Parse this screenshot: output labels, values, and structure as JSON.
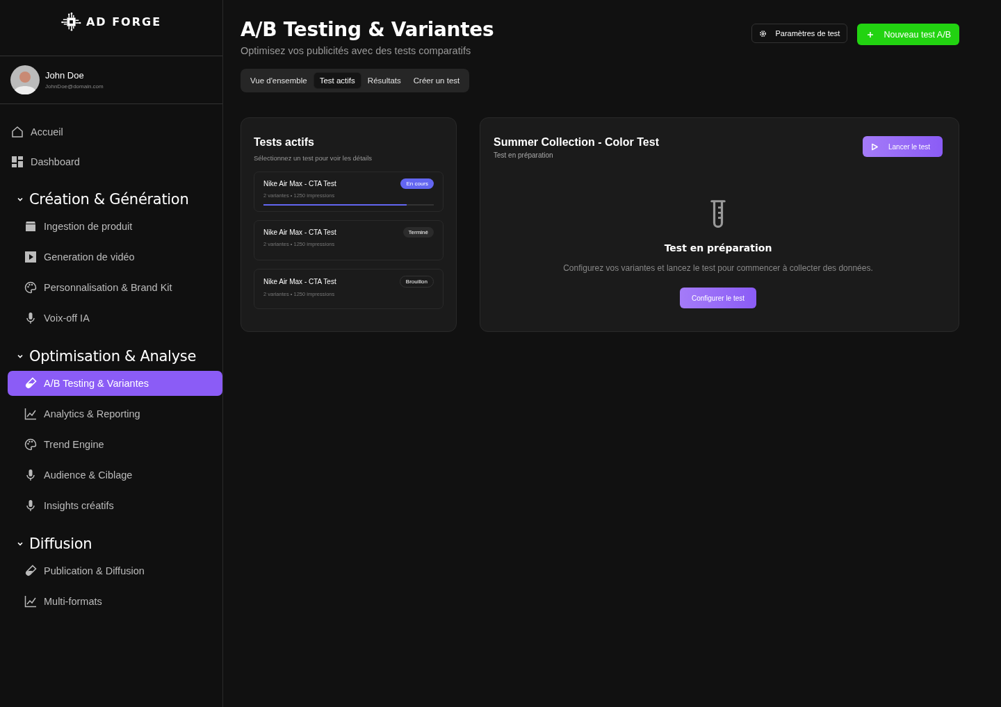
{
  "brand": {
    "name": "AD FORGE"
  },
  "user": {
    "name": "John Doe",
    "email": "JohnDoe@domain.com"
  },
  "nav": [
    {
      "label": "Accueil",
      "kind": "home",
      "selected": false
    },
    {
      "label": "Dashboard",
      "kind": "dashboard",
      "selected": false
    }
  ],
  "sections": [
    {
      "title": "Création & Génération",
      "expanded": true,
      "items": [
        {
          "label": "Ingestion de produit",
          "kind": "box",
          "selected": false
        },
        {
          "label": "Generation de vidéo",
          "kind": "video",
          "selected": false
        },
        {
          "label": "Personnalisation & Brand Kit",
          "kind": "palette",
          "selected": false
        },
        {
          "label": "Voix-off IA",
          "kind": "mic",
          "selected": false
        }
      ]
    },
    {
      "title": "Optimisation & Analyse",
      "expanded": true,
      "items": [
        {
          "label": "A/B Testing & Variantes",
          "kind": "tube",
          "selected": true
        },
        {
          "label": "Analytics & Reporting",
          "kind": "chart",
          "selected": false
        },
        {
          "label": "Trend Engine",
          "kind": "palette",
          "selected": false
        },
        {
          "label": "Audience & Ciblage",
          "kind": "mic",
          "selected": false
        },
        {
          "label": "Insights créatifs",
          "kind": "mic",
          "selected": false
        }
      ]
    },
    {
      "title": "Diffusion",
      "expanded": true,
      "items": [
        {
          "label": "Publication & Diffusion",
          "kind": "tube",
          "selected": false
        },
        {
          "label": "Multi-formats",
          "kind": "chart",
          "selected": false
        }
      ]
    }
  ],
  "page": {
    "title": "A/B Testing & Variantes",
    "subtitle": "Optimisez vos publicités avec des tests comparatifs"
  },
  "header_buttons": [
    {
      "label": "Paramètres de test",
      "kind": "settings"
    },
    {
      "label": "Nouveau test A/B",
      "kind": "new"
    }
  ],
  "tabs": [
    {
      "label": "Vue d'ensemble",
      "selected": false
    },
    {
      "label": "Test actifs",
      "selected": true
    },
    {
      "label": "Résultats",
      "selected": false
    },
    {
      "label": "Créer un test",
      "selected": false
    }
  ],
  "tests_panel": {
    "title": "Tests actifs",
    "subtitle": "Sélectionnez un test pour voir les détails",
    "tests": [
      {
        "name": "Nike Air Max - CTA Test",
        "meta": "2 variantes • 1250 impressions",
        "status": "En cours",
        "kind": "running",
        "level": 0.84
      },
      {
        "name": "Nike Air Max - CTA Test",
        "meta": "2 variantes • 1250 impressions",
        "status": "Terminé",
        "kind": "done"
      },
      {
        "name": "Nike Air Max - CTA Test",
        "meta": "2 variantes • 1250 impressions",
        "status": "Brouillon",
        "kind": "draft"
      }
    ]
  },
  "detail": {
    "title": "Summer Collection - Color Test",
    "subtitle": "Test en préparation",
    "launch_button": "Lancer le test",
    "empty_title": "Test en préparation",
    "empty_text": "Configurez vos variantes et lancez le test pour commencer à collecter des données.",
    "configure_button": "Configurer le test"
  }
}
